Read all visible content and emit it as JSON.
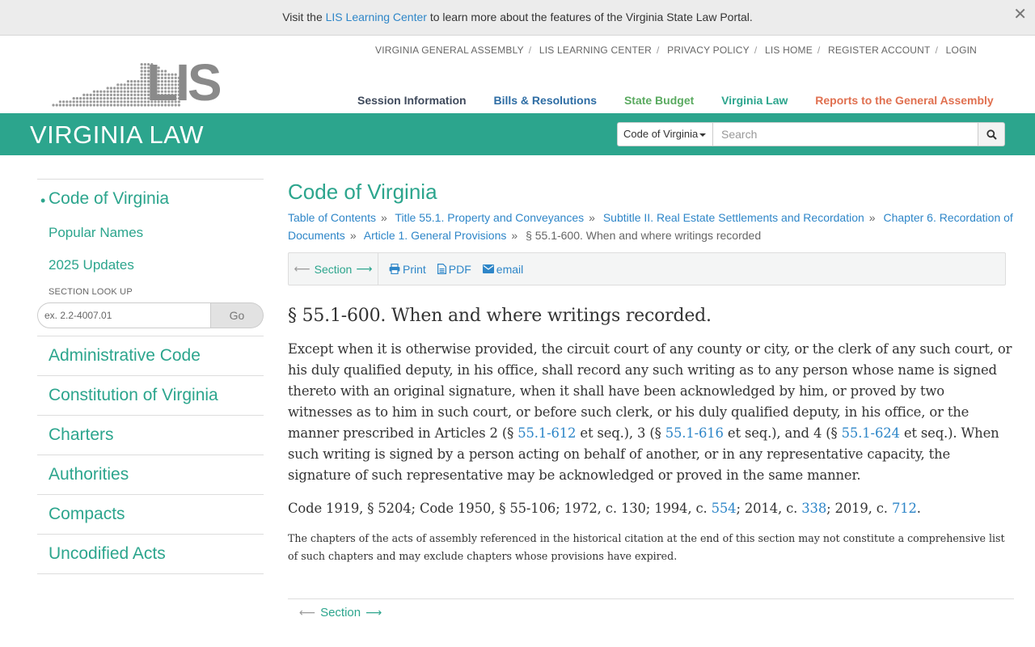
{
  "banner": {
    "text_before": "Visit the",
    "link": "LIS Learning Center",
    "text_after": "to learn more about the features of the Virginia State Law Portal.",
    "close": "✕"
  },
  "utility_nav": [
    "VIRGINIA GENERAL ASSEMBLY",
    "LIS LEARNING CENTER",
    "PRIVACY POLICY",
    "LIS HOME",
    "REGISTER ACCOUNT",
    "LOGIN"
  ],
  "utility_sep": "/",
  "logo_text": "LIS",
  "main_nav": [
    {
      "label": "Session Information",
      "color": "#3f4a5c"
    },
    {
      "label": "Bills & Resolutions",
      "color": "#2e6da4"
    },
    {
      "label": "State Budget",
      "color": "#5aaa60"
    },
    {
      "label": "Virginia Law",
      "color": "#2ca58d"
    },
    {
      "label": "Reports to the General Assembly",
      "color": "#e07050"
    }
  ],
  "header": {
    "title": "VIRGINIA LAW",
    "scope_label": "Code of Virginia",
    "search_placeholder": "Search"
  },
  "sidebar": {
    "current": "Code of Virginia",
    "bullet": "•",
    "sub_items": [
      "Popular Names",
      "2025 Updates"
    ],
    "lookup_label": "SECTION LOOK UP",
    "lookup_placeholder": "ex. 2.2-4007.01",
    "lookup_button": "Go",
    "items": [
      "Administrative Code",
      "Constitution of Virginia",
      "Charters",
      "Authorities",
      "Compacts",
      "Uncodified Acts"
    ]
  },
  "content": {
    "title": "Code of Virginia",
    "breadcrumbs": [
      "Table of Contents",
      "Title 55.1. Property and Conveyances",
      "Subtitle II. Real Estate Settlements and Recordation",
      "Chapter 6. Recordation of Documents",
      "Article 1. General Provisions"
    ],
    "breadcrumb_current": "§ 55.1-600. When and where writings recorded",
    "breadcrumb_sep": "»",
    "toolbar": {
      "section_label": "Section",
      "left_arrow": "⟵",
      "right_arrow": "⟶",
      "print": "Print",
      "pdf": "PDF",
      "email": "email"
    },
    "section_heading": "§ 55.1-600. When and where writings recorded.",
    "body": {
      "p1": "Except when it is otherwise provided, the circuit court of any county or city, or the clerk of any such court, or his duly qualified deputy, in his office, shall record any such writing as to any person whose name is signed thereto with an original signature, when it shall have been acknowledged by him, or proved by two witnesses as to him in such court, or before such clerk, or his duly qualified deputy, in his office, or the manner prescribed in Articles 2 (§ ",
      "link1": "55.1-612",
      "p2": " et seq.), 3 (§ ",
      "link2": "55.1-616",
      "p3": " et seq.), and 4 (§ ",
      "link3": "55.1-624",
      "p4": " et seq.). When such writing is signed by a person acting on behalf of another, or in any representative capacity, the signature of such representative may be acknowledged or proved in the same manner."
    },
    "history": {
      "t1": "Code 1919, § 5204; Code 1950, § 55-106; 1972, c. 130; 1994, c. ",
      "l1": "554",
      "t2": "; 2014, c. ",
      "l2": "338",
      "t3": "; 2019, c. ",
      "l3": "712",
      "t4": "."
    },
    "note": "The chapters of the acts of assembly referenced in the historical citation at the end of this section may not constitute a comprehensive list of such chapters and may exclude chapters whose provisions have expired.",
    "bottom_section_label": "Section"
  },
  "colors": {
    "accent": "#2ca58d",
    "link": "#2e86c8"
  }
}
